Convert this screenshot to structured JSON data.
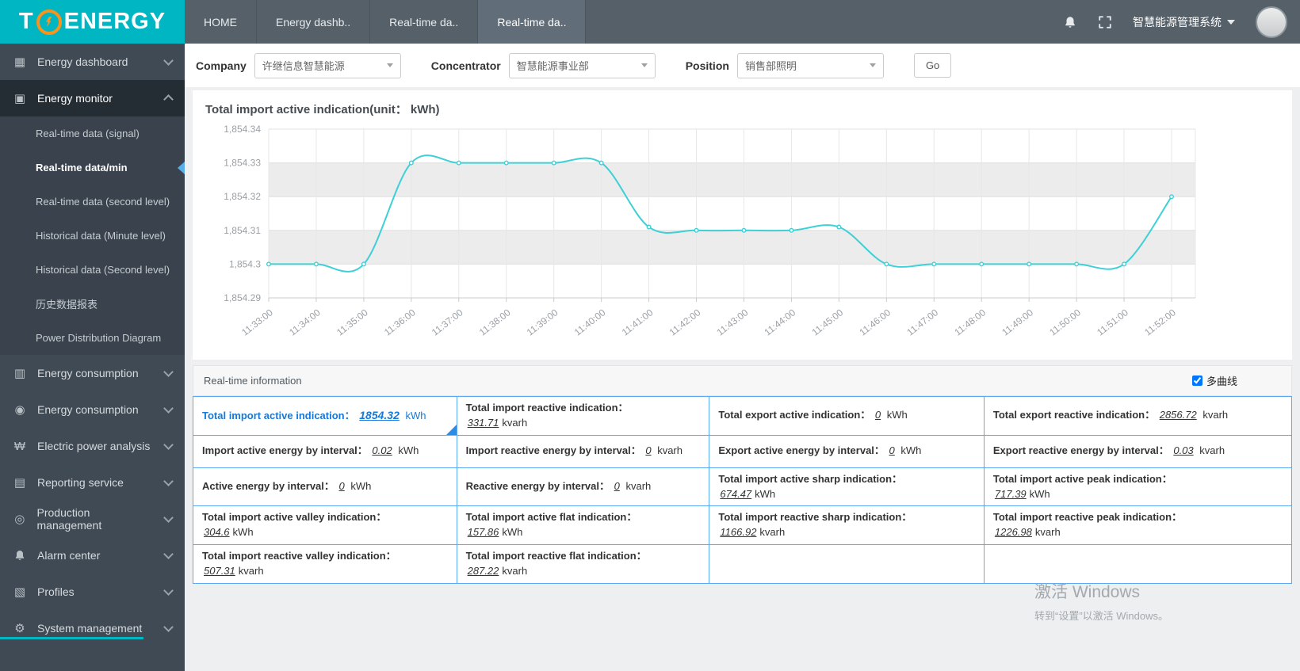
{
  "logo": {
    "prefix": "T",
    "suffix": "ENERGY"
  },
  "header": {
    "tabs": [
      {
        "label": "HOME",
        "active": false
      },
      {
        "label": "Energy dashb..",
        "active": false
      },
      {
        "label": "Real-time da..",
        "active": false
      },
      {
        "label": "Real-time da..",
        "active": true
      }
    ],
    "system_name": "智慧能源管理系统"
  },
  "sidebar": {
    "items": [
      {
        "label": "Energy dashboard",
        "icon": "dashboard-icon",
        "glyph": "▦"
      },
      {
        "label": "Energy monitor",
        "icon": "video-monitor-icon",
        "glyph": "▣",
        "active": true,
        "expanded": true,
        "children": [
          {
            "label": "Real-time data (signal)"
          },
          {
            "label": "Real-time data/min",
            "active": true
          },
          {
            "label": "Real-time data (second level)"
          },
          {
            "label": "Historical data (Minute level)"
          },
          {
            "label": "Historical data (Second level)"
          },
          {
            "label": "历史数据报表"
          },
          {
            "label": "Power Distribution Diagram"
          }
        ]
      },
      {
        "label": "Energy consumption",
        "icon": "bar-chart-icon",
        "glyph": "▥"
      },
      {
        "label": "Energy consumption",
        "icon": "leaf-icon",
        "glyph": "◉"
      },
      {
        "label": "Electric power analysis",
        "icon": "power-watt-icon",
        "glyph": "₩"
      },
      {
        "label": "Reporting service",
        "icon": "report-icon",
        "glyph": "▤"
      },
      {
        "label": "Production management",
        "icon": "production-icon",
        "glyph": "◎"
      },
      {
        "label": "Alarm center",
        "icon": "bell-icon",
        "glyph": "bell"
      },
      {
        "label": "Profiles",
        "icon": "profiles-icon",
        "glyph": "▧"
      },
      {
        "label": "System management",
        "icon": "gear-icon",
        "glyph": "⚙"
      }
    ]
  },
  "filters": {
    "company": {
      "label": "Company",
      "value": "许继信息智慧能源"
    },
    "concentrator": {
      "label": "Concentrator",
      "value": "智慧能源事业部"
    },
    "position": {
      "label": "Position",
      "value": "销售部照明"
    },
    "go_label": "Go"
  },
  "chart_data": {
    "type": "line",
    "title": "Total import active indication(unit： kWh)",
    "x": [
      "11:33:00",
      "11:34:00",
      "11:35:00",
      "11:36:00",
      "11:37:00",
      "11:38:00",
      "11:39:00",
      "11:40:00",
      "11:41:00",
      "11:42:00",
      "11:43:00",
      "11:44:00",
      "11:45:00",
      "11:46:00",
      "11:47:00",
      "11:48:00",
      "11:49:00",
      "11:50:00",
      "11:51:00",
      "11:52:00"
    ],
    "series": [
      {
        "name": "Total import active indication",
        "values": [
          1854.3,
          1854.3,
          1854.3,
          1854.33,
          1854.33,
          1854.33,
          1854.33,
          1854.33,
          1854.311,
          1854.31,
          1854.31,
          1854.31,
          1854.311,
          1854.3,
          1854.3,
          1854.3,
          1854.3,
          1854.3,
          1854.3,
          1854.32
        ]
      }
    ],
    "ylim": [
      1854.29,
      1854.34
    ],
    "y_ticks": [
      "1,854.29",
      "1,854.3",
      "1,854.31",
      "1,854.32",
      "1,854.33",
      "1,854.34"
    ],
    "line_color": "#3fd0d6",
    "grid": true,
    "legend_position": "none"
  },
  "realtime": {
    "panel_title": "Real-time information",
    "multi_curve_label": "多曲线",
    "multi_curve_checked": true,
    "rows": [
      [
        {
          "label": "Total import active indication：",
          "value": "1854.32",
          "unit": "kWh",
          "highlight": true
        },
        {
          "label": "Total import reactive indication：",
          "value": "331.71",
          "unit": "kvarh",
          "block": true
        },
        {
          "label": "Total export active indication：",
          "value": "0",
          "unit": "kWh"
        },
        {
          "label": "Total export reactive indication：",
          "value": "2856.72",
          "unit": "kvarh"
        }
      ],
      [
        {
          "label": "Import active energy by interval：",
          "value": "0.02",
          "unit": "kWh"
        },
        {
          "label": "Import reactive energy by interval：",
          "value": "0",
          "unit": "kvarh"
        },
        {
          "label": "Export active energy by interval：",
          "value": "0",
          "unit": "kWh"
        },
        {
          "label": "Export reactive energy by interval：",
          "value": "0.03",
          "unit": "kvarh"
        }
      ],
      [
        {
          "label": "Active energy by interval：",
          "value": "0",
          "unit": "kWh"
        },
        {
          "label": "Reactive energy by interval：",
          "value": "0",
          "unit": "kvarh"
        },
        {
          "label": "Total import active sharp indication：",
          "value": "674.47",
          "unit": "kWh",
          "block": true
        },
        {
          "label": "Total import active peak indication：",
          "value": "717.39",
          "unit": "kWh",
          "block": true
        }
      ],
      [
        {
          "label": "Total import active valley indication：",
          "value": "304.6",
          "unit": "kWh",
          "block": true
        },
        {
          "label": "Total import active flat indication：",
          "value": "157.86",
          "unit": "kWh",
          "block": true
        },
        {
          "label": "Total import reactive sharp indication：",
          "value": "1166.92",
          "unit": "kvarh",
          "block": true
        },
        {
          "label": "Total import reactive peak indication：",
          "value": "1226.98",
          "unit": "kvarh",
          "block": true
        }
      ],
      [
        {
          "label": "Total import reactive valley indication：",
          "value": "507.31",
          "unit": "kvarh",
          "block": true
        },
        {
          "label": "Total import reactive flat indication：",
          "value": "287.22",
          "unit": "kvarh",
          "block": true
        },
        null,
        null
      ]
    ]
  },
  "watermark": {
    "line1": "激活 Windows",
    "line2": "转到“设置”以激活 Windows。"
  }
}
